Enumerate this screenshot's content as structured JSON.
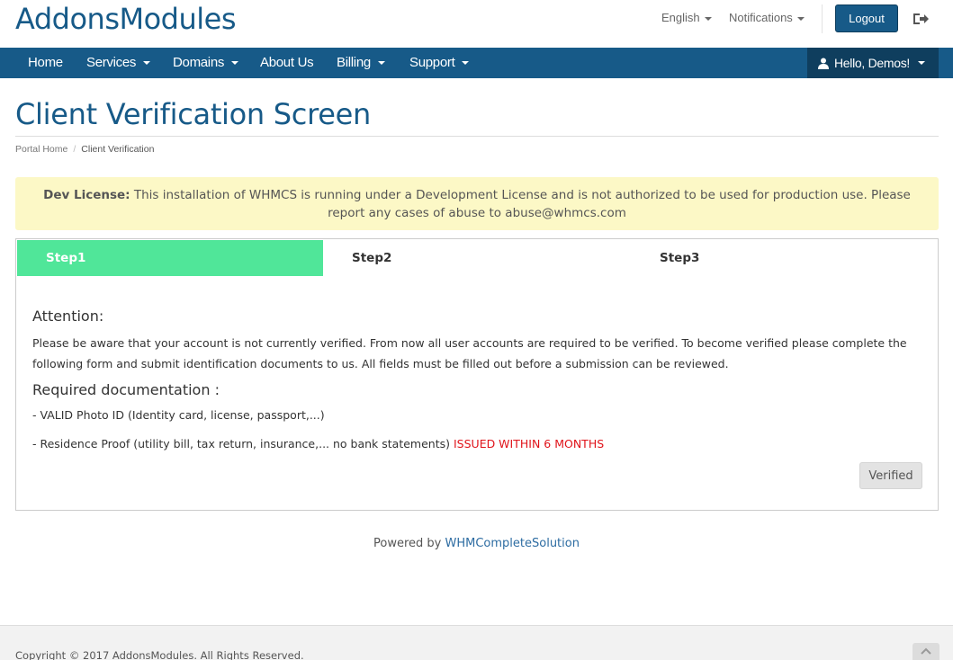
{
  "header": {
    "logo": "AddonsModules",
    "language": "English",
    "notifications": "Notifications",
    "logout": "Logout"
  },
  "nav": {
    "items": [
      {
        "label": "Home",
        "dropdown": false
      },
      {
        "label": "Services",
        "dropdown": true
      },
      {
        "label": "Domains",
        "dropdown": true
      },
      {
        "label": "About Us",
        "dropdown": false
      },
      {
        "label": "Billing",
        "dropdown": true
      },
      {
        "label": "Support",
        "dropdown": true
      }
    ],
    "user": "Hello, Demos!"
  },
  "page": {
    "title": "Client Verification Screen",
    "breadcrumb": [
      "Portal Home",
      "Client Verification"
    ]
  },
  "alert": {
    "label": "Dev License:",
    "text": "This installation of WHMCS is running under a Development License and is not authorized to be used for production use. Please report any cases of abuse to abuse@whmcs.com"
  },
  "steps": [
    "Step1",
    "Step2",
    "Step3"
  ],
  "content": {
    "attention": "Attention:",
    "paragraph": "Please be aware that your account is not currently verified. From now all user accounts are required to be verified. To become verified please complete the following form and submit identification documents to us. All fields must be filled out before a submission can be reviewed.",
    "required_heading": "Required documentation :",
    "item1": "- VALID Photo ID (Identity card, license, passport,...)",
    "item2": "- Residence Proof (utility bill, tax return, insurance,... no bank statements) ",
    "item2_highlight": "ISSUED WITHIN 6 MONTHS",
    "verified_button": "Verified"
  },
  "footer": {
    "powered_prefix": "Powered by ",
    "powered_link": "WHMCompleteSolution",
    "copyright": "Copyright © 2017 AddonsModules. All Rights Reserved."
  },
  "colors": {
    "brand": "#175a88",
    "step_active": "#50e699",
    "alert_bg": "#fcf8c6",
    "highlight_red": "#e0131a"
  }
}
